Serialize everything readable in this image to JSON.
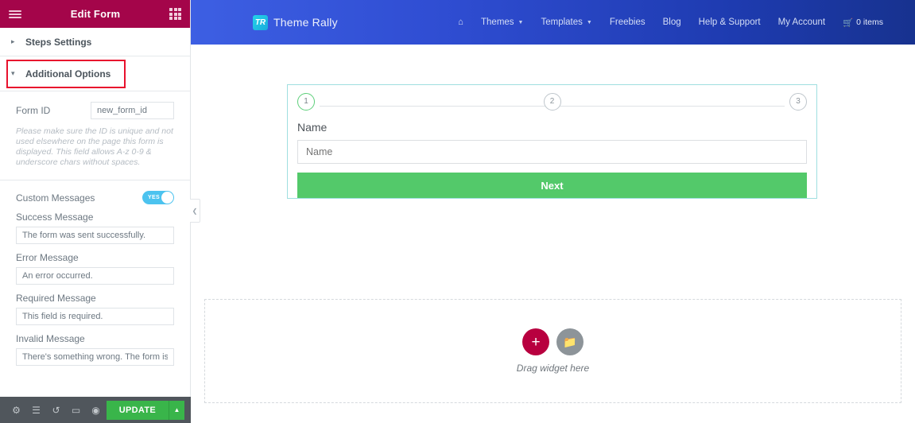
{
  "panel": {
    "title": "Edit Form",
    "menu_icon": "hamburger-icon",
    "grid_icon": "apps-grid-icon",
    "accordions": [
      {
        "label": "Steps Settings",
        "state": "collapsed",
        "caret": "▸"
      },
      {
        "label": "Additional Options",
        "state": "expanded",
        "caret": "▾"
      }
    ],
    "form_id": {
      "label": "Form ID",
      "value": "new_form_id",
      "help": "Please make sure the ID is unique and not used elsewhere on the page this form is displayed. This field allows A-z  0-9 & underscore chars without spaces."
    },
    "custom_messages": {
      "label": "Custom Messages",
      "toggle_state": "YES",
      "toggle_color": "#4cc3ef"
    },
    "messages": [
      {
        "label": "Success Message",
        "value": "The form was sent successfully."
      },
      {
        "label": "Error Message",
        "value": "An error occurred."
      },
      {
        "label": "Required Message",
        "value": "This field is required."
      },
      {
        "label": "Invalid Message",
        "value": "There's something wrong. The form is inval"
      }
    ],
    "footer": {
      "icons": [
        {
          "name": "settings-gear-icon",
          "glyph": "⚙"
        },
        {
          "name": "navigator-layers-icon",
          "glyph": "☰"
        },
        {
          "name": "history-icon",
          "glyph": "↺"
        },
        {
          "name": "responsive-mode-icon",
          "glyph": "▭"
        },
        {
          "name": "preview-eye-icon",
          "glyph": "◉"
        }
      ],
      "update_label": "UPDATE",
      "update_caret": "▲",
      "update_color": "#39b54a"
    },
    "highlight_color": "#e8112d"
  },
  "canvas": {
    "collapse_handle": "❮",
    "site_header": {
      "brand_mark": "TR",
      "brand_name": "Theme Rally",
      "nav": [
        {
          "label": "",
          "icon": "home-icon",
          "glyph": "⌂",
          "has_caret": false
        },
        {
          "label": "Themes",
          "has_caret": true
        },
        {
          "label": "Templates",
          "has_caret": true
        },
        {
          "label": "Freebies",
          "has_caret": false
        },
        {
          "label": "Blog",
          "has_caret": false
        },
        {
          "label": "Help & Support",
          "has_caret": false
        },
        {
          "label": "My Account",
          "has_caret": false
        }
      ],
      "cart": {
        "icon": "cart-icon",
        "glyph": "🛒",
        "label": "0 items"
      }
    },
    "form_widget": {
      "steps": [
        {
          "number": "1",
          "active": true
        },
        {
          "number": "2",
          "active": false
        },
        {
          "number": "3",
          "active": false
        }
      ],
      "field_label": "Name",
      "field_placeholder": "Name",
      "submit_label": "Next",
      "submit_color": "#53c96a",
      "selection_color": "#9fdfe0"
    },
    "drop_zone": {
      "add_button": "+",
      "add_color": "#b8003f",
      "template_button_icon": "folder-icon",
      "template_glyph": "📁",
      "text": "Drag widget here"
    }
  }
}
